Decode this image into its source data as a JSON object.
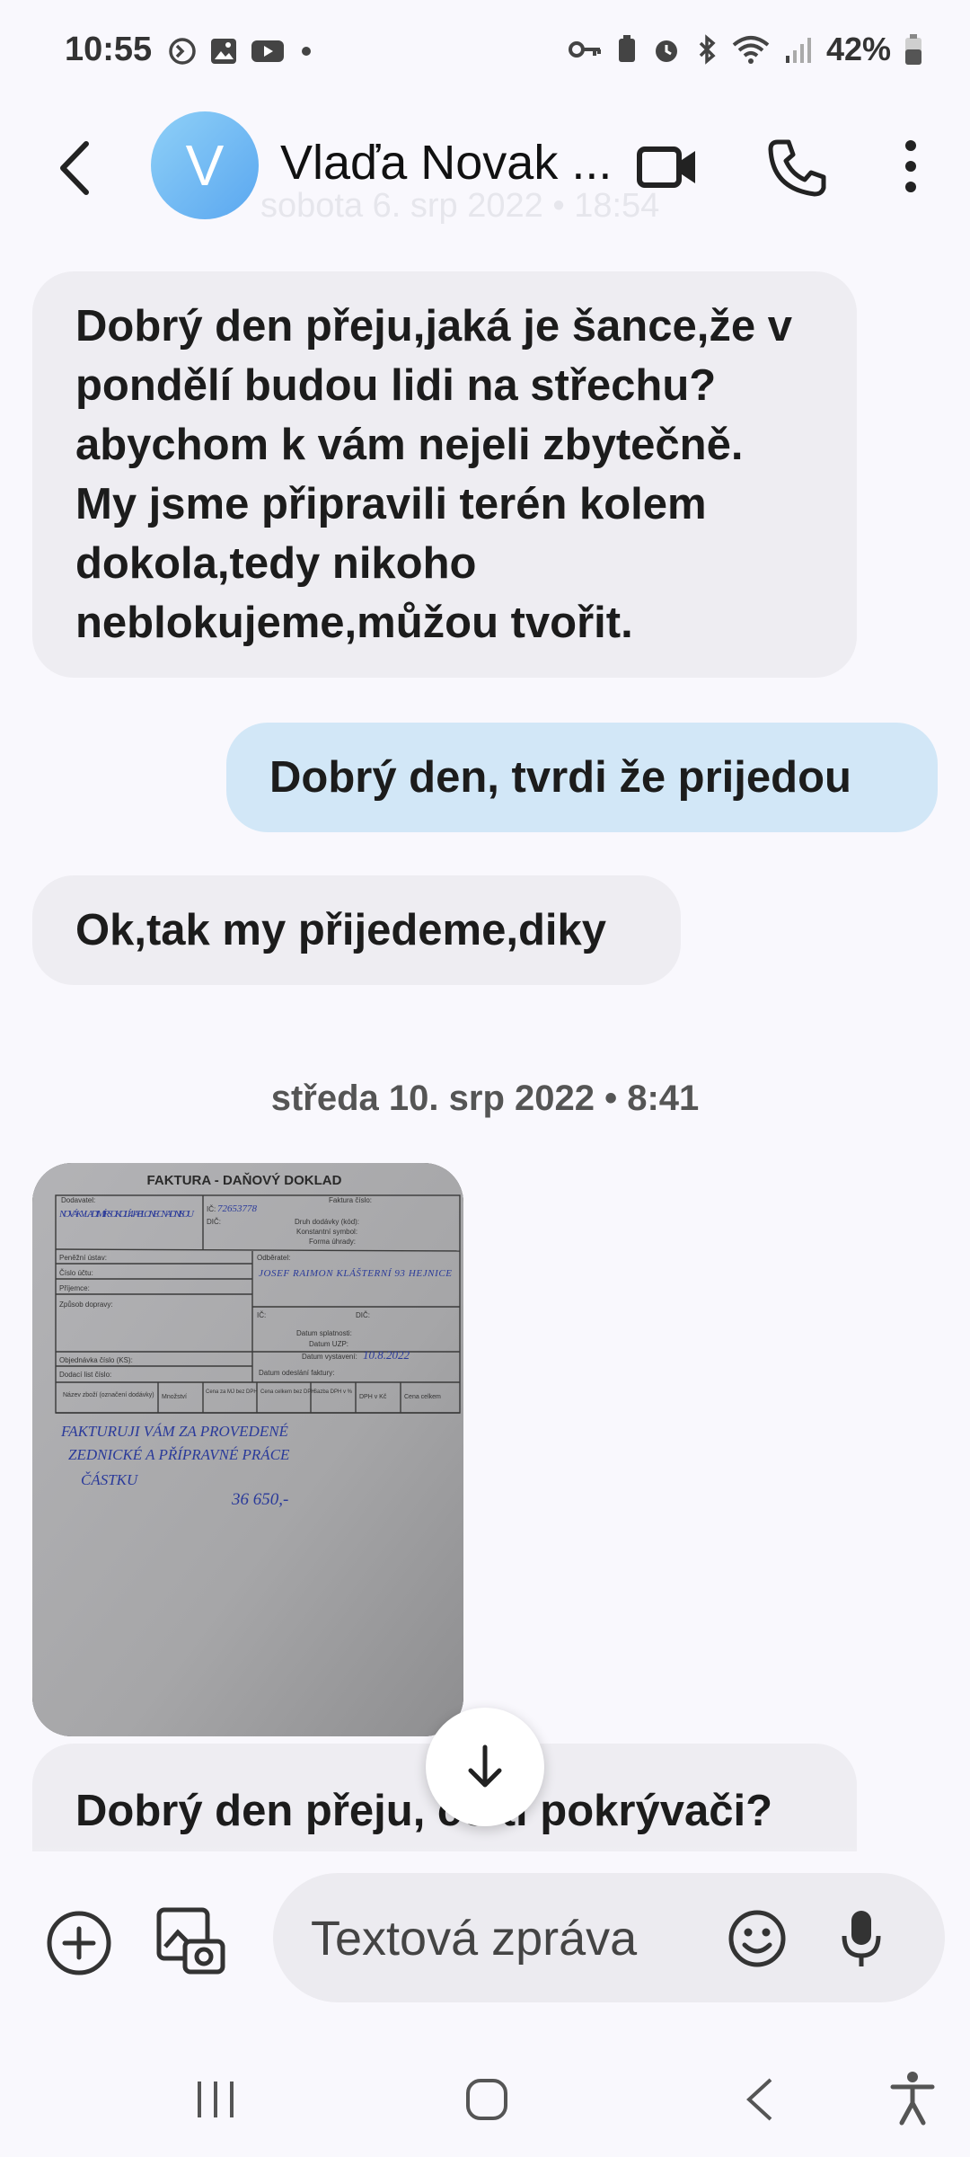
{
  "status_bar": {
    "time": "10:55",
    "battery": "42%"
  },
  "header": {
    "avatar_letter": "V",
    "contact_name": "Vlaďa Novak ...",
    "faded_date": "sobota 6. srp 2022 • 18:54"
  },
  "messages": [
    {
      "direction": "incoming",
      "text": "Dobrý den přeju,jaká je šance,že v pondělí budou lidi na střechu?abychom k vám nejeli zbytečně. My jsme připravili terén kolem dokola,tedy nikoho neblokujeme,můžou tvořit."
    },
    {
      "direction": "outgoing",
      "text": "Dobrý den,  tvrdi že prijedou"
    },
    {
      "direction": "incoming",
      "text": "Ok,tak my přijedeme,diky"
    }
  ],
  "date_separator": "středa 10. srp 2022 • 8:41",
  "attachment": {
    "doc_title": "FAKTURA - DAŇOVÝ DOKLAD",
    "supplier_label": "Dodavatel:",
    "supplier_hand": "NOVÁK VLADIMÍR SOKOLÍ 4 JABLONEC NAD NISOU",
    "ico_label": "IČ:",
    "ico_hand": "72653778",
    "dic_label": "DIČ:",
    "invoice_no_label": "Faktura číslo:",
    "delivery_type_label": "Druh dodávky (kód):",
    "const_symbol_label": "Konstantní symbol:",
    "payment_form_label": "Forma úhrady:",
    "bank_label": "Peněžní ústav:",
    "account_label": "Číslo účtu:",
    "recipient_label": "Příjemce:",
    "transport_label": "Způsob dopravy:",
    "customer_label": "Odběratel:",
    "customer_hand": "JOSEF RAIMON KLÁŠTERNÍ 93 HEJNICE",
    "order_label": "Objednávka číslo (KS):",
    "delivery_note_label": "Dodací list číslo:",
    "due_label": "Datum splatnosti:",
    "uzp_label": "Datum UZP:",
    "issue_label": "Datum vystavení:",
    "issue_hand": "10.8.2022",
    "sent_label": "Datum odeslání faktury:",
    "col_goods": "Název zboží (označení dodávky)",
    "col_qty": "Množství",
    "col_unit": "Cena za MJ bez DPH",
    "col_total": "Cena celkem bez DPH",
    "col_rate": "Sazba DPH v %",
    "col_vat": "DPH v Kč",
    "col_sum": "Cena celkem",
    "body_hand_1": "FAKTURUJI VÁM ZA PROVEDENÉ",
    "body_hand_2": "ZEDNICKÉ A PŘÍPRAVNÉ PRÁCE",
    "body_hand_3": "ČÁSTKU",
    "body_hand_amount": "36 650,-"
  },
  "partial_message": "Dobrý den přeju, co ti pokrývači? V příloze vám posílám",
  "composer": {
    "placeholder": "Textová zpráva"
  },
  "colors": {
    "incoming_bubble": "#eeedf2",
    "outgoing_bubble": "#d2e7f7",
    "background": "#f9f8fd"
  }
}
